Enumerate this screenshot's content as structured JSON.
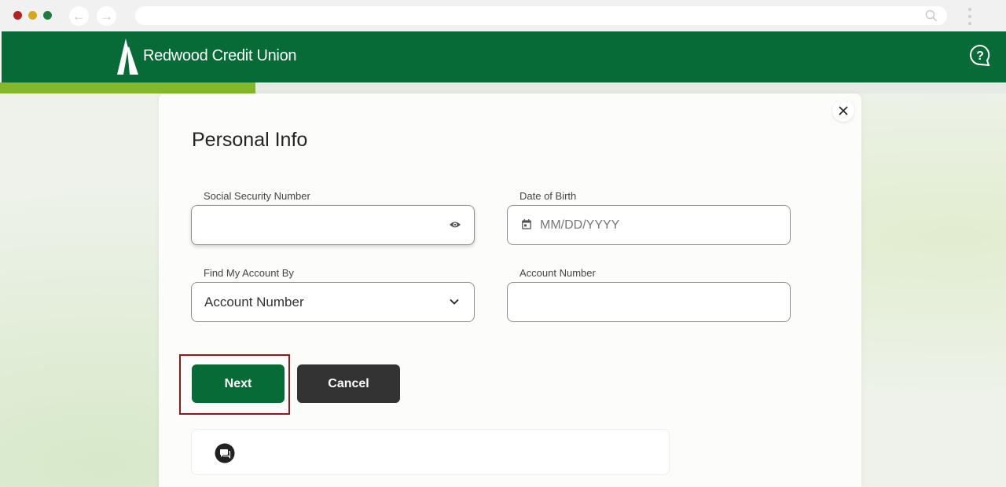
{
  "browser": {
    "url": "",
    "icons": [
      "back-arrow-icon",
      "forward-arrow-icon",
      "search-icon",
      "kebab-menu-icon"
    ]
  },
  "header": {
    "brand": "Redwood Credit Union",
    "icons": [
      "redwood-logo-icon",
      "help-chat-icon"
    ],
    "colors": {
      "header_bg": "#066b37",
      "progress": "#84b72a"
    }
  },
  "progress": {
    "fraction": 0.254
  },
  "form": {
    "title": "Personal Info",
    "ssn": {
      "label": "Social Security Number",
      "value": ""
    },
    "dob": {
      "label": "Date of Birth",
      "placeholder": "MM/DD/YYYY"
    },
    "find_by": {
      "label": "Find My Account By",
      "selected": "Account Number"
    },
    "account_number": {
      "label": "Account Number",
      "value": ""
    }
  },
  "buttons": {
    "next": "Next",
    "cancel": "Cancel",
    "colors": {
      "next": "#066b37",
      "cancel": "#333333",
      "highlight": "#8e1b1b"
    }
  }
}
